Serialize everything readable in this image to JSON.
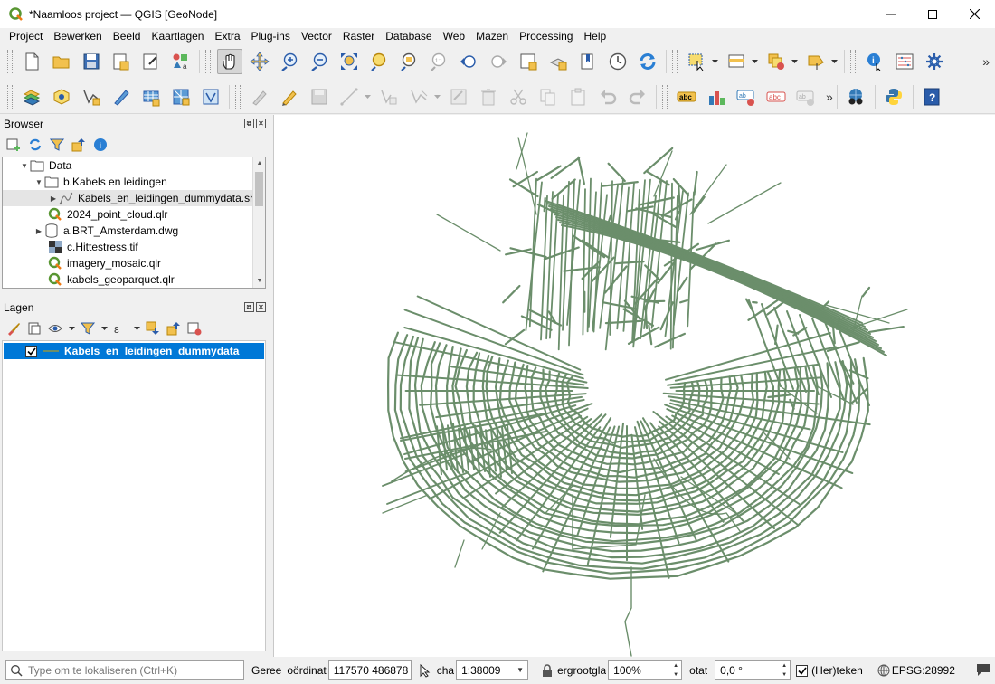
{
  "window": {
    "title": "*Naamloos project — QGIS [GeoNode]"
  },
  "menu": [
    {
      "label": "Project"
    },
    {
      "label": "Bewerken"
    },
    {
      "label": "Beeld"
    },
    {
      "label": "Kaartlagen"
    },
    {
      "label": "Extra"
    },
    {
      "label": "Plug-ins"
    },
    {
      "label": "Vector"
    },
    {
      "label": "Raster"
    },
    {
      "label": "Database"
    },
    {
      "label": "Web"
    },
    {
      "label": "Mazen"
    },
    {
      "label": "Processing"
    },
    {
      "label": "Help"
    }
  ],
  "browser": {
    "title": "Browser",
    "items": [
      {
        "label": "Data",
        "icon": "folder-icon",
        "arrow": "▼"
      },
      {
        "label": "b.Kabels en leidingen",
        "icon": "folder-icon",
        "arrow": "▼"
      },
      {
        "label": "Kabels_en_leidingen_dummydata.shp",
        "icon": "vector-line-icon",
        "arrow": "▶"
      },
      {
        "label": "2024_point_cloud.qlr",
        "icon": "qgis-layer-definition-icon",
        "arrow": ""
      },
      {
        "label": "a.BRT_Amsterdam.dwg",
        "icon": "database-icon",
        "arrow": "▶"
      },
      {
        "label": "c.Hittestress.tif",
        "icon": "raster-icon",
        "arrow": ""
      },
      {
        "label": "imagery_mosaic.qlr",
        "icon": "qgis-layer-definition-icon",
        "arrow": ""
      },
      {
        "label": "kabels_geoparquet.qlr",
        "icon": "qgis-layer-definition-icon",
        "arrow": ""
      }
    ]
  },
  "layers": {
    "title": "Lagen",
    "items": [
      {
        "label": "Kabels_en_leidingen_dummydata",
        "checked": true,
        "color": "#6b8e6b"
      }
    ]
  },
  "status": {
    "locator_placeholder": "Type om te lokaliseren (Ctrl+K)",
    "ready_label": "Geree",
    "coord_label": "oördinat",
    "coordinate": "117570  486878",
    "scale_label": "cha",
    "scale": "1:38009",
    "magnifier_label": "ergrootgla",
    "magnifier": "100%",
    "rotation_label": "otat",
    "rotation": "0,0 °",
    "render_label": "(Her)teken",
    "crs": "EPSG:28992"
  },
  "colors": {
    "accent": "#0078d7",
    "map_features": "#6b8e6b"
  }
}
